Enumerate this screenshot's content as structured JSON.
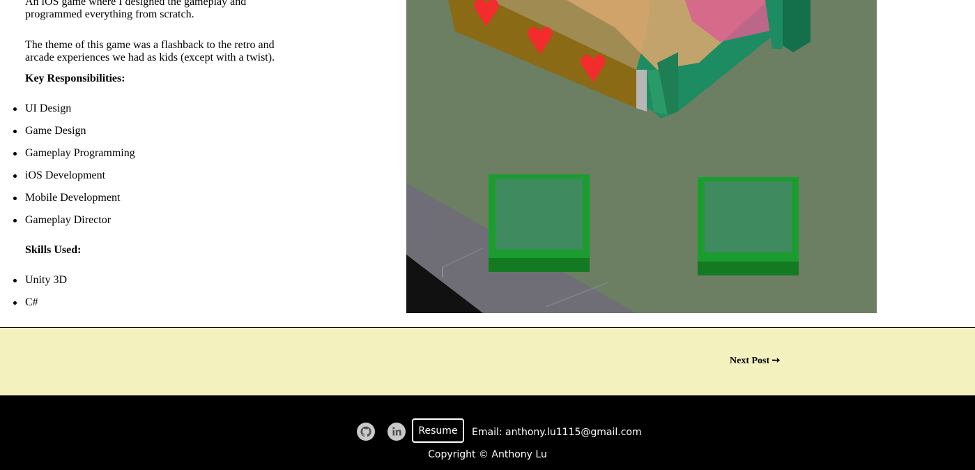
{
  "article": {
    "intro": "An iOS game where I designed the gameplay and programmed everything from scratch.",
    "theme": "The theme of this game was a flashback to the retro and arcade experiences we had as kids (except with a twist).",
    "responsibilities_heading": "Key Responsibilities:",
    "responsibilities": [
      "UI Design",
      "Game Design",
      "Gameplay Programming",
      "iOS Development",
      "Mobile Development",
      "Gameplay Director"
    ],
    "skills_heading": "Skills Used:",
    "skills": [
      "Unity 3D",
      "C#"
    ]
  },
  "post_nav": {
    "next_label": "Next Post ➙"
  },
  "footer": {
    "github_icon": "github-icon",
    "linkedin_icon": "linkedin-icon",
    "resume_label": "Resume",
    "email": "Email: anthony.lu1115@gmail.com",
    "copyright": "Copyright © Anthony Lu"
  },
  "colors": {
    "post_nav_bg": "#f3f2bf",
    "footer_bg": "#000000",
    "game_bg": "#6c7f63"
  }
}
